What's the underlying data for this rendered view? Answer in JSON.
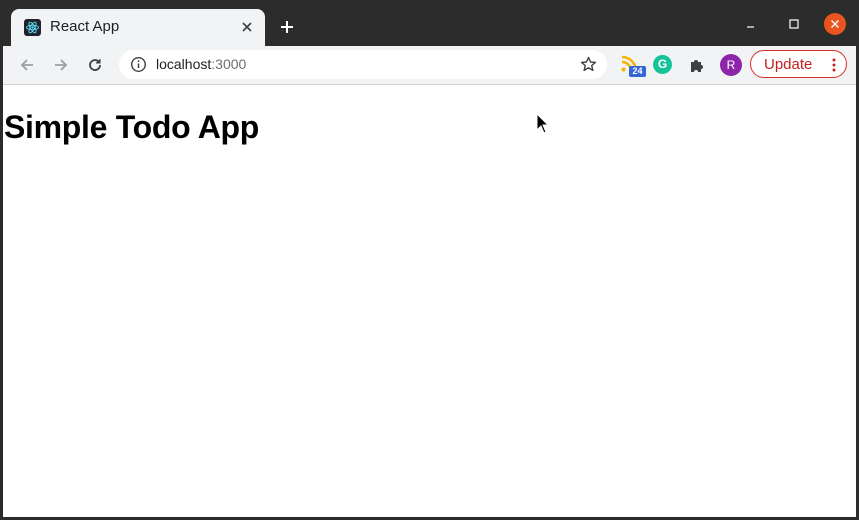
{
  "browser": {
    "tab": {
      "title": "React App",
      "favicon": "react-logo-icon"
    },
    "address_bar": {
      "host": "localhost",
      "port": ":3000"
    },
    "extensions": {
      "rss_badge": "24",
      "grammarly_letter": "G"
    },
    "profile_initial": "R",
    "update_label": "Update"
  },
  "page": {
    "heading": "Simple Todo App"
  },
  "colors": {
    "titlebar": "#2c2c2c",
    "toolbar": "#f1f3f4",
    "update_accent": "#d93025",
    "avatar": "#8e24aa",
    "close_button": "#e9541f"
  }
}
